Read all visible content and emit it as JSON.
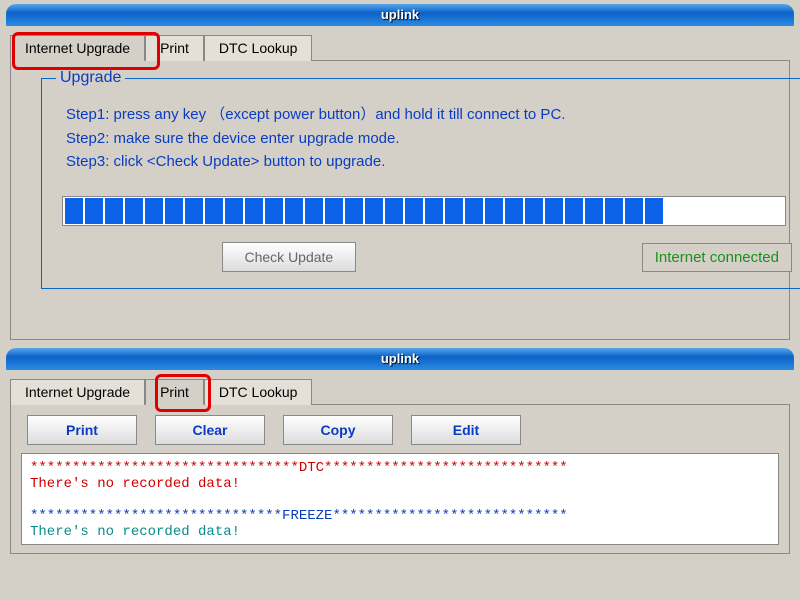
{
  "window1": {
    "title": "uplink",
    "tabs": [
      "Internet Upgrade",
      "Print",
      "DTC Lookup"
    ],
    "active_tab": 0,
    "group_label": "Upgrade",
    "steps": [
      "Step1: press any key （except power button）and hold it till connect to PC.",
      "Step2: make sure the device enter upgrade mode.",
      "Step3: click <Check Update> button to upgrade."
    ],
    "progress_segments_total": 36,
    "progress_segments_filled": 30,
    "check_button": "Check Update",
    "status": "Internet connected"
  },
  "window2": {
    "title": "uplink",
    "tabs": [
      "Internet Upgrade",
      "Print",
      "DTC Lookup"
    ],
    "active_tab": 1,
    "toolbar": [
      "Print",
      "Clear",
      "Copy",
      "Edit"
    ],
    "console": {
      "line1": "********************************DTC*****************************",
      "line2": "  There's no recorded data!",
      "line3": "******************************FREEZE****************************",
      "line4": "  There's no recorded data!"
    }
  },
  "highlights": {
    "h1_label": "Internet Upgrade highlight",
    "h2_label": "Print highlight"
  }
}
